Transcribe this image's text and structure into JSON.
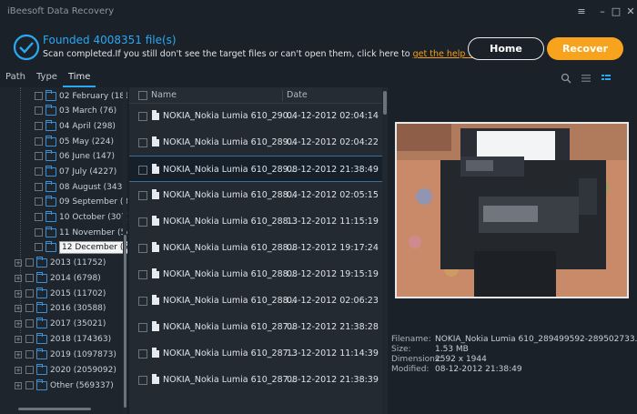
{
  "window": {
    "title": "iBeesoft Data Recovery",
    "controls": [
      "≡",
      "–",
      "□",
      "✕"
    ]
  },
  "header": {
    "found_text": "Founded 4008351 file(s)",
    "scan_message": "Scan completed.If you still don't see the target files or can't open them, click here to ",
    "help_link": "get the help >>",
    "home_label": "Home",
    "recover_label": "Recover"
  },
  "tabs": [
    {
      "label": "Path"
    },
    {
      "label": "Type"
    },
    {
      "label": "Time"
    }
  ],
  "tree": {
    "months": [
      {
        "label": "02 February (181)"
      },
      {
        "label": "03 March (76)"
      },
      {
        "label": "04 April (298)"
      },
      {
        "label": "05 May (224)"
      },
      {
        "label": "06 June (147)"
      },
      {
        "label": "07 July (4227)"
      },
      {
        "label": "08 August (343)"
      },
      {
        "label": "09 September (333"
      },
      {
        "label": "10 October (307)"
      },
      {
        "label": "11 November (544"
      },
      {
        "label": "12 December (540)"
      }
    ],
    "years": [
      {
        "label": "2013 (11752)"
      },
      {
        "label": "2014 (6798)"
      },
      {
        "label": "2015 (11702)"
      },
      {
        "label": "2016 (30588)"
      },
      {
        "label": "2017 (35021)"
      },
      {
        "label": "2018 (174363)"
      },
      {
        "label": "2019 (1097873)"
      },
      {
        "label": "2020 (2059092)"
      },
      {
        "label": "Other (569337)"
      }
    ]
  },
  "list": {
    "col_name": "Name",
    "col_date": "Date",
    "rows": [
      {
        "name": "NOKIA_Nokia Lumia 610_290...",
        "date": "04-12-2012 02:04:14"
      },
      {
        "name": "NOKIA_Nokia Lumia 610_289...",
        "date": "04-12-2012 02:04:22"
      },
      {
        "name": "NOKIA_Nokia Lumia 610_289...",
        "date": "08-12-2012 21:38:49"
      },
      {
        "name": "NOKIA_Nokia Lumia 610_288...",
        "date": "04-12-2012 02:05:15"
      },
      {
        "name": "NOKIA_Nokia Lumia 610_288...",
        "date": "13-12-2012 11:15:19"
      },
      {
        "name": "NOKIA_Nokia Lumia 610_288...",
        "date": "08-12-2012 19:17:24"
      },
      {
        "name": "NOKIA_Nokia Lumia 610_288...",
        "date": "08-12-2012 19:15:19"
      },
      {
        "name": "NOKIA_Nokia Lumia 610_288...",
        "date": "04-12-2012 02:06:23"
      },
      {
        "name": "NOKIA_Nokia Lumia 610_287...",
        "date": "08-12-2012 21:38:28"
      },
      {
        "name": "NOKIA_Nokia Lumia 610_287...",
        "date": "13-12-2012 11:14:39"
      },
      {
        "name": "NOKIA_Nokia Lumia 610_287...",
        "date": "08-12-2012 21:38:39"
      }
    ]
  },
  "preview": {
    "filename_key": "Filename:",
    "filename": "NOKIA_Nokia Lumia 610_289499592-289502733...",
    "size_key": "Size:",
    "size": "1.53 MB",
    "dimensions_key": "Dimensions:",
    "dimensions": "2592 x 1944",
    "modified_key": "Modified:",
    "modified": "08-12-2012 21:38:49"
  },
  "colors": {
    "accent": "#2aa8f2",
    "recover": "#f7a31d",
    "link": "#f5a014"
  }
}
